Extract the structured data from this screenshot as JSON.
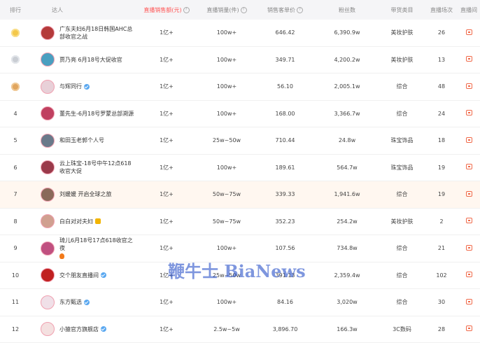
{
  "header": {
    "rank": "排行",
    "anchor": "达人",
    "sales_amount": "直播销售额(元)",
    "sales_volume": "直播销量(件)",
    "avg_price": "销售客单价",
    "fans": "粉丝数",
    "category": "带货类目",
    "live_count": "直播场次",
    "live_room": "直播间"
  },
  "rows": [
    {
      "rank": "",
      "medal": "gold",
      "name": "广东夫妇6月18日韩国AHC总部收官之战",
      "amount": "1亿+",
      "volume": "100w+",
      "price": "646.42",
      "fans": "6,390.9w",
      "category": "美妆护肤",
      "count": "26",
      "avatar_color": "#b43a3a"
    },
    {
      "rank": "",
      "medal": "silver",
      "name": "贾乃亮 6月18号大促收官",
      "amount": "1亿+",
      "volume": "100w+",
      "price": "349.71",
      "fans": "4,200.2w",
      "category": "美妆护肤",
      "count": "13",
      "avatar_color": "#4a9fc0"
    },
    {
      "rank": "",
      "medal": "bronze",
      "name": "与辉同行",
      "amount": "1亿+",
      "volume": "100w+",
      "price": "56.10",
      "fans": "2,005.1w",
      "category": "综合",
      "count": "48",
      "avatar_color": "#e8d0d8",
      "verified": true
    },
    {
      "rank": "4",
      "name": "董先生-6月18号罗蒙总部溯源",
      "amount": "1亿+",
      "volume": "100w+",
      "price": "168.00",
      "fans": "3,366.7w",
      "category": "综合",
      "count": "24",
      "avatar_color": "#c04060"
    },
    {
      "rank": "5",
      "name": "和田玉老郭个人号",
      "amount": "1亿+",
      "volume": "25w~50w",
      "price": "710.44",
      "fans": "24.8w",
      "category": "珠宝饰品",
      "count": "18",
      "avatar_color": "#6a7a8a"
    },
    {
      "rank": "6",
      "name": "云上珠宝-18号中午12点618收官大促",
      "amount": "1亿+",
      "volume": "100w+",
      "price": "189.61",
      "fans": "564.7w",
      "category": "珠宝饰品",
      "count": "19",
      "avatar_color": "#9a3a4a"
    },
    {
      "rank": "7",
      "name": "刘媛媛 开启全球之旅",
      "amount": "1亿+",
      "volume": "50w~75w",
      "price": "339.33",
      "fans": "1,941.6w",
      "category": "综合",
      "count": "19",
      "avatar_color": "#8a6a5a",
      "highlight": true
    },
    {
      "rank": "8",
      "name": "白白对对夫妇",
      "amount": "1亿+",
      "volume": "50w~75w",
      "price": "352.23",
      "fans": "254.2w",
      "category": "美妆护肤",
      "count": "2",
      "avatar_color": "#d0a090",
      "crown": true
    },
    {
      "rank": "9",
      "name": "琦儿6月18号17点618收官之夜",
      "amount": "1亿+",
      "volume": "100w+",
      "price": "107.56",
      "fans": "734.8w",
      "category": "综合",
      "count": "21",
      "avatar_color": "#c05080",
      "flame": true
    },
    {
      "rank": "10",
      "name": "交个朋友直播间",
      "amount": "1亿+",
      "volume": "25w~50w",
      "price": "391.13",
      "fans": "2,359.4w",
      "category": "综合",
      "count": "102",
      "avatar_color": "#c02020",
      "verified": true
    },
    {
      "rank": "11",
      "name": "东方甄选",
      "amount": "1亿+",
      "volume": "100w+",
      "price": "84.16",
      "fans": "3,020w",
      "category": "综合",
      "count": "30",
      "avatar_color": "#f0e0e8",
      "verified": true
    },
    {
      "rank": "12",
      "name": "小猿官方旗舰店",
      "amount": "1亿+",
      "volume": "2.5w~5w",
      "price": "3,896.70",
      "fans": "166.3w",
      "category": "3C数码",
      "count": "28",
      "avatar_color": "#f4e0e0",
      "verified": true
    }
  ],
  "watermark": "鞭牛士 BiaNews"
}
